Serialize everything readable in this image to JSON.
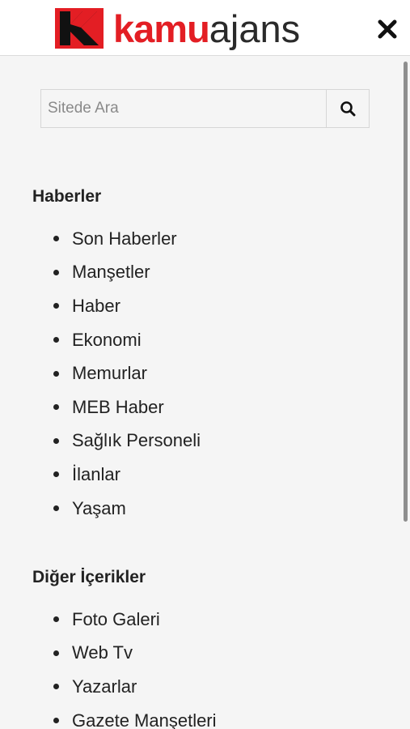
{
  "header": {
    "logo_kamu": "kamu",
    "logo_ajans": "ajans",
    "brand_color": "#e31e24",
    "close_icon": "close-icon"
  },
  "search": {
    "placeholder": "Sitede Ara",
    "value": "",
    "icon": "search-icon"
  },
  "sections": [
    {
      "title": "Haberler",
      "items": [
        "Son Haberler",
        "Manşetler",
        "Haber",
        "Ekonomi",
        "Memurlar",
        "MEB Haber",
        "Sağlık Personeli",
        "İlanlar",
        "Yaşam"
      ]
    },
    {
      "title": "Diğer İçerikler",
      "items": [
        "Foto Galeri",
        "Web Tv",
        "Yazarlar",
        "Gazete Manşetleri"
      ]
    }
  ]
}
